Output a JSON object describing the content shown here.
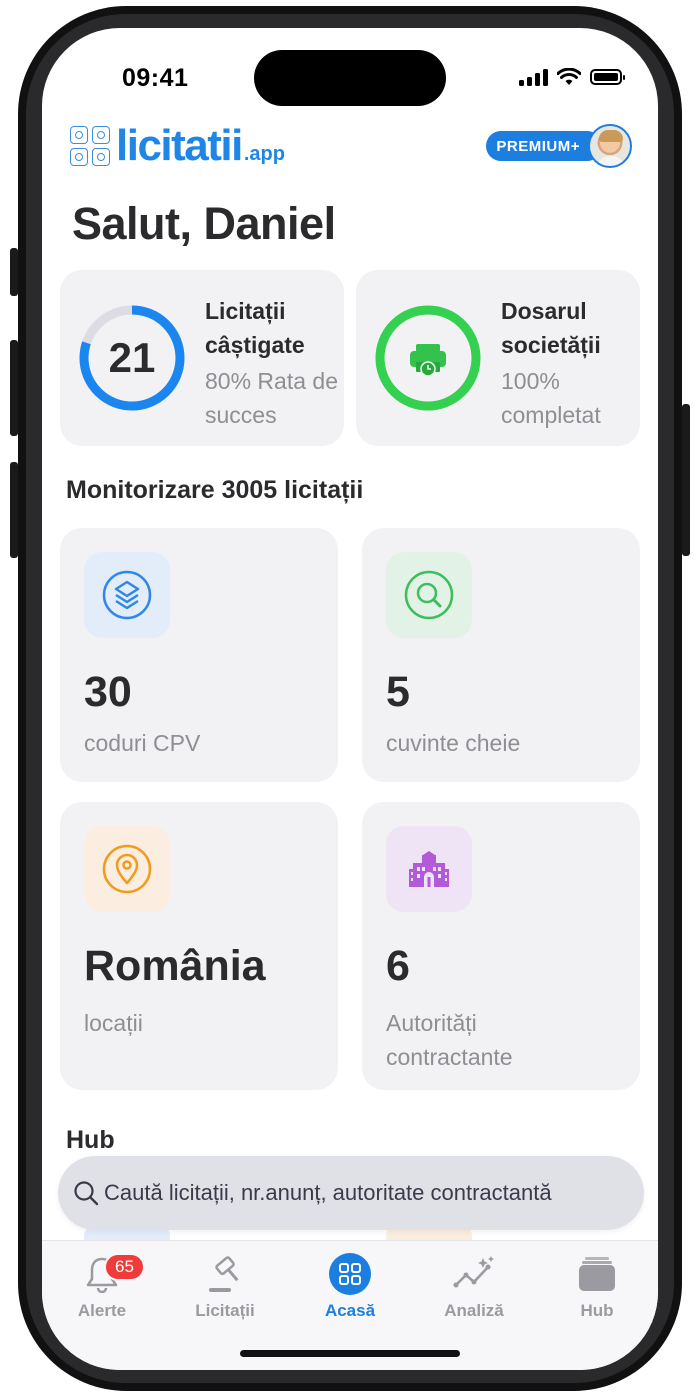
{
  "status": {
    "time": "09:41"
  },
  "header": {
    "logo_text": "licitatii",
    "logo_suffix": ".app",
    "premium_label": "PREMIUM+"
  },
  "greeting": "Salut, Daniel",
  "summary_cards": [
    {
      "value": "21",
      "title": "Licitații câștigate",
      "subtitle": "80% Rata de succes",
      "progress": 0.8,
      "color": "#1c86f0"
    },
    {
      "title": "Dosarul societății",
      "subtitle": "100% completat",
      "progress": 1.0,
      "color": "#33d14f"
    }
  ],
  "monitor": {
    "title": "Monitorizare 3005 licitații",
    "tiles": [
      {
        "value": "30",
        "label": "coduri CPV",
        "icon": "layers-icon",
        "tint": "#e3edf9",
        "color": "#2f88e8"
      },
      {
        "value": "5",
        "label": "cuvinte cheie",
        "icon": "search-icon",
        "tint": "#e3f2e6",
        "color": "#3bbf5a"
      },
      {
        "value": "România",
        "label": "locații",
        "icon": "location-pin-icon",
        "tint": "#fbeee0",
        "color": "#f29a1e"
      },
      {
        "value": "6",
        "label": "Autorități contractante",
        "icon": "building-icon",
        "tint": "#efe4f6",
        "color": "#b25ad8"
      }
    ]
  },
  "hub": {
    "title": "Hub"
  },
  "search": {
    "placeholder": "Caută licitații, nr.anunț, autoritate contractantă"
  },
  "tabs": [
    {
      "label": "Alerte",
      "badge": "65",
      "icon": "bell-icon"
    },
    {
      "label": "Licitații",
      "icon": "gavel-icon"
    },
    {
      "label": "Acasă",
      "icon": "grid-icon",
      "active": true
    },
    {
      "label": "Analiză",
      "icon": "analytics-icon"
    },
    {
      "label": "Hub",
      "icon": "folder-icon"
    }
  ]
}
